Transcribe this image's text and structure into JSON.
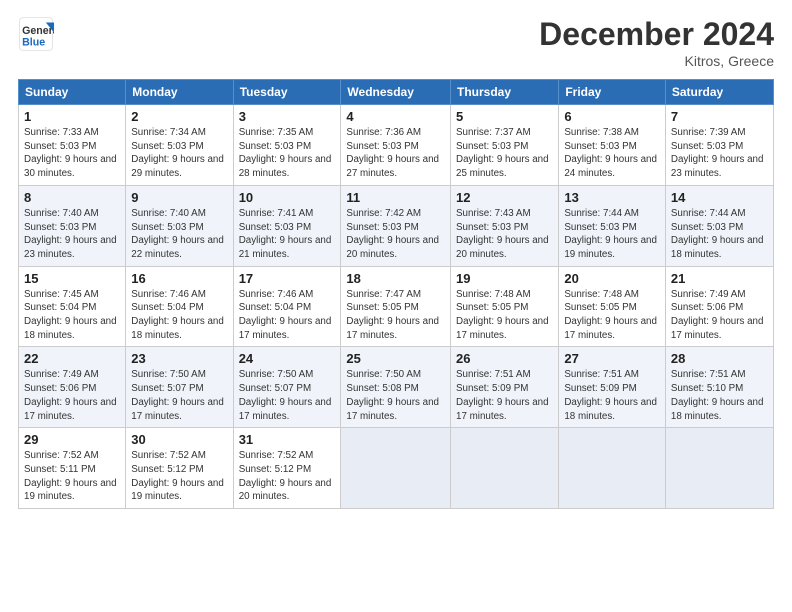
{
  "header": {
    "logo_line1": "General",
    "logo_line2": "Blue",
    "title": "December 2024",
    "location": "Kitros, Greece"
  },
  "weekdays": [
    "Sunday",
    "Monday",
    "Tuesday",
    "Wednesday",
    "Thursday",
    "Friday",
    "Saturday"
  ],
  "weeks": [
    [
      {
        "day": "1",
        "sunrise": "7:33 AM",
        "sunset": "5:03 PM",
        "daylight": "9 hours and 30 minutes."
      },
      {
        "day": "2",
        "sunrise": "7:34 AM",
        "sunset": "5:03 PM",
        "daylight": "9 hours and 29 minutes."
      },
      {
        "day": "3",
        "sunrise": "7:35 AM",
        "sunset": "5:03 PM",
        "daylight": "9 hours and 28 minutes."
      },
      {
        "day": "4",
        "sunrise": "7:36 AM",
        "sunset": "5:03 PM",
        "daylight": "9 hours and 27 minutes."
      },
      {
        "day": "5",
        "sunrise": "7:37 AM",
        "sunset": "5:03 PM",
        "daylight": "9 hours and 25 minutes."
      },
      {
        "day": "6",
        "sunrise": "7:38 AM",
        "sunset": "5:03 PM",
        "daylight": "9 hours and 24 minutes."
      },
      {
        "day": "7",
        "sunrise": "7:39 AM",
        "sunset": "5:03 PM",
        "daylight": "9 hours and 23 minutes."
      }
    ],
    [
      {
        "day": "8",
        "sunrise": "7:40 AM",
        "sunset": "5:03 PM",
        "daylight": "9 hours and 23 minutes."
      },
      {
        "day": "9",
        "sunrise": "7:40 AM",
        "sunset": "5:03 PM",
        "daylight": "9 hours and 22 minutes."
      },
      {
        "day": "10",
        "sunrise": "7:41 AM",
        "sunset": "5:03 PM",
        "daylight": "9 hours and 21 minutes."
      },
      {
        "day": "11",
        "sunrise": "7:42 AM",
        "sunset": "5:03 PM",
        "daylight": "9 hours and 20 minutes."
      },
      {
        "day": "12",
        "sunrise": "7:43 AM",
        "sunset": "5:03 PM",
        "daylight": "9 hours and 20 minutes."
      },
      {
        "day": "13",
        "sunrise": "7:44 AM",
        "sunset": "5:03 PM",
        "daylight": "9 hours and 19 minutes."
      },
      {
        "day": "14",
        "sunrise": "7:44 AM",
        "sunset": "5:03 PM",
        "daylight": "9 hours and 18 minutes."
      }
    ],
    [
      {
        "day": "15",
        "sunrise": "7:45 AM",
        "sunset": "5:04 PM",
        "daylight": "9 hours and 18 minutes."
      },
      {
        "day": "16",
        "sunrise": "7:46 AM",
        "sunset": "5:04 PM",
        "daylight": "9 hours and 18 minutes."
      },
      {
        "day": "17",
        "sunrise": "7:46 AM",
        "sunset": "5:04 PM",
        "daylight": "9 hours and 17 minutes."
      },
      {
        "day": "18",
        "sunrise": "7:47 AM",
        "sunset": "5:05 PM",
        "daylight": "9 hours and 17 minutes."
      },
      {
        "day": "19",
        "sunrise": "7:48 AM",
        "sunset": "5:05 PM",
        "daylight": "9 hours and 17 minutes."
      },
      {
        "day": "20",
        "sunrise": "7:48 AM",
        "sunset": "5:05 PM",
        "daylight": "9 hours and 17 minutes."
      },
      {
        "day": "21",
        "sunrise": "7:49 AM",
        "sunset": "5:06 PM",
        "daylight": "9 hours and 17 minutes."
      }
    ],
    [
      {
        "day": "22",
        "sunrise": "7:49 AM",
        "sunset": "5:06 PM",
        "daylight": "9 hours and 17 minutes."
      },
      {
        "day": "23",
        "sunrise": "7:50 AM",
        "sunset": "5:07 PM",
        "daylight": "9 hours and 17 minutes."
      },
      {
        "day": "24",
        "sunrise": "7:50 AM",
        "sunset": "5:07 PM",
        "daylight": "9 hours and 17 minutes."
      },
      {
        "day": "25",
        "sunrise": "7:50 AM",
        "sunset": "5:08 PM",
        "daylight": "9 hours and 17 minutes."
      },
      {
        "day": "26",
        "sunrise": "7:51 AM",
        "sunset": "5:09 PM",
        "daylight": "9 hours and 17 minutes."
      },
      {
        "day": "27",
        "sunrise": "7:51 AM",
        "sunset": "5:09 PM",
        "daylight": "9 hours and 18 minutes."
      },
      {
        "day": "28",
        "sunrise": "7:51 AM",
        "sunset": "5:10 PM",
        "daylight": "9 hours and 18 minutes."
      }
    ],
    [
      {
        "day": "29",
        "sunrise": "7:52 AM",
        "sunset": "5:11 PM",
        "daylight": "9 hours and 19 minutes."
      },
      {
        "day": "30",
        "sunrise": "7:52 AM",
        "sunset": "5:12 PM",
        "daylight": "9 hours and 19 minutes."
      },
      {
        "day": "31",
        "sunrise": "7:52 AM",
        "sunset": "5:12 PM",
        "daylight": "9 hours and 20 minutes."
      },
      null,
      null,
      null,
      null
    ]
  ],
  "labels": {
    "sunrise": "Sunrise:",
    "sunset": "Sunset:",
    "daylight": "Daylight:"
  }
}
